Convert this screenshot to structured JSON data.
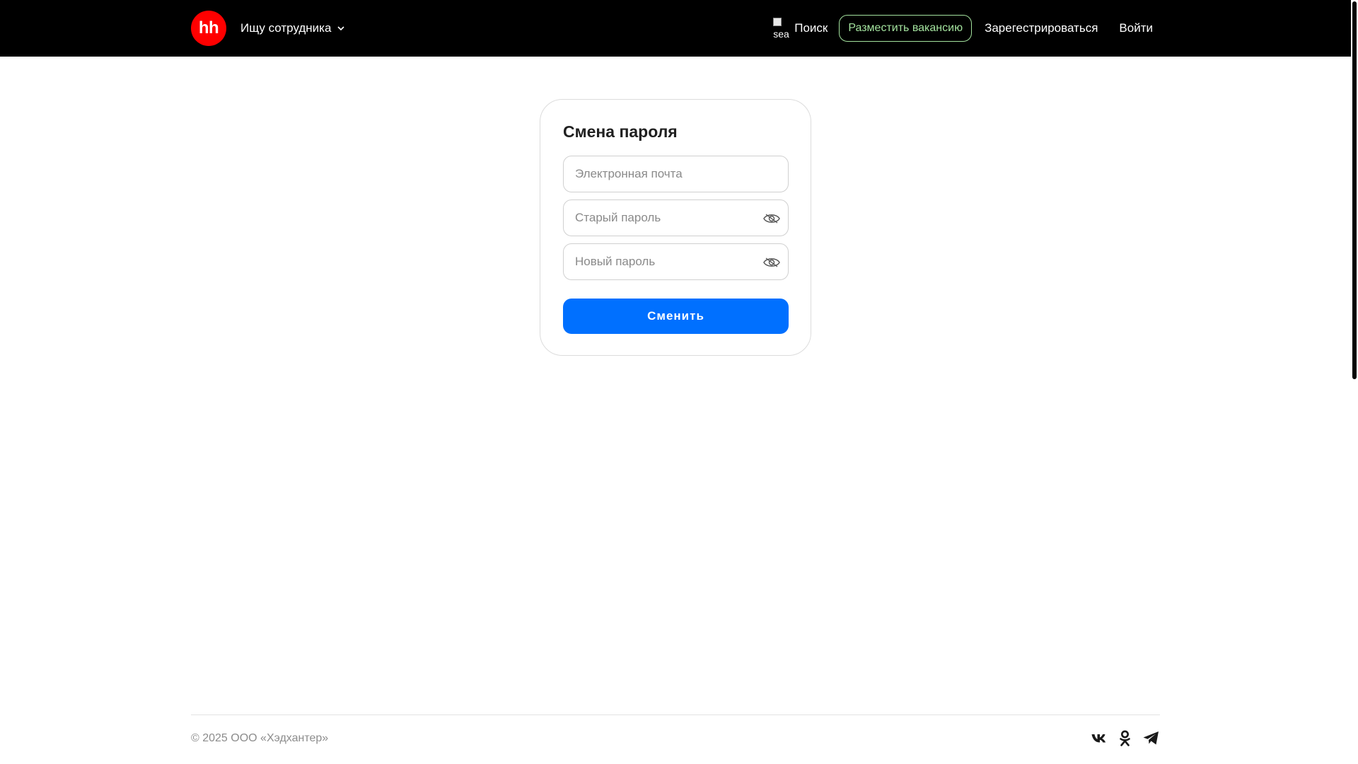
{
  "header": {
    "logo_text": "hh",
    "role_switch_label": "Ищу сотрудника",
    "search_broken_alt": "sea",
    "search_label": "Поиск",
    "post_vacancy_label": "Разместить вакансию",
    "register_label": "Зарегестрироваться",
    "login_label": "Войти"
  },
  "form": {
    "title": "Смена пароля",
    "email_placeholder": "Электронная почта",
    "old_password_placeholder": "Старый пароль",
    "new_password_placeholder": "Новый пароль",
    "email_value": "",
    "old_password_value": "",
    "new_password_value": "",
    "submit_label": "Сменить"
  },
  "footer": {
    "copyright": "© 2025 ООО «Хэдхантер»",
    "socials": [
      "vk-icon",
      "odnoklassniki-icon",
      "telegram-icon"
    ]
  },
  "colors": {
    "header_bg": "#000000",
    "logo_red": "#ff0000",
    "accent_green": "#a3e29e",
    "primary_blue": "#0070ff"
  },
  "icons": {
    "role_chevron": "chevron-down-icon",
    "search": "search-icon",
    "password_toggle": "eye-icon"
  }
}
